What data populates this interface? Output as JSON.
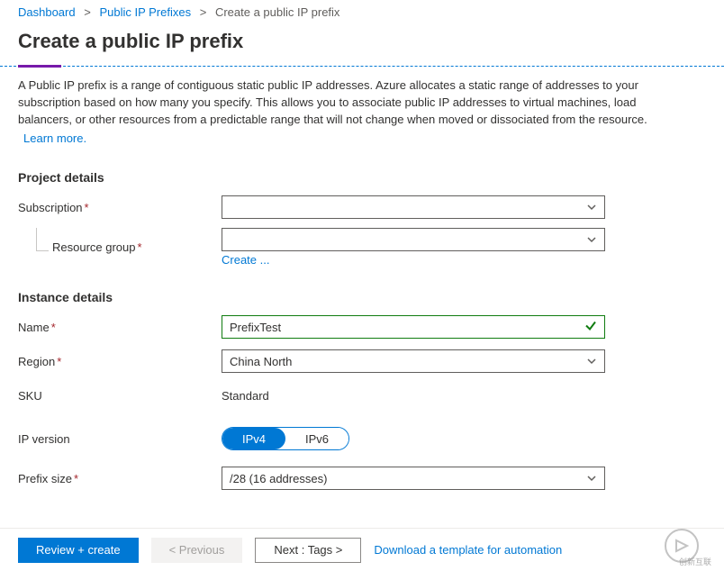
{
  "breadcrumb": {
    "dashboard": "Dashboard",
    "prefixes": "Public IP Prefixes",
    "current": "Create a public IP prefix"
  },
  "page": {
    "title": "Create a public IP prefix",
    "description": "A Public IP prefix is a range of contiguous static public IP addresses. Azure allocates a static range of addresses to your subscription based on how many you specify. This allows you to associate public IP addresses to virtual machines, load balancers, or other resources from a predictable range that will not change when moved or dissociated from the resource.",
    "learn_more": "Learn more."
  },
  "sections": {
    "project_details": "Project details",
    "instance_details": "Instance details"
  },
  "labels": {
    "subscription": "Subscription",
    "resource_group": "Resource group",
    "name": "Name",
    "region": "Region",
    "sku": "SKU",
    "ip_version": "IP version",
    "prefix_size": "Prefix size",
    "required_marker": "*"
  },
  "values": {
    "subscription": "",
    "resource_group": "",
    "create_new": "Create ...",
    "name": "PrefixTest",
    "region": "China North",
    "sku": "Standard",
    "ip_v4": "IPv4",
    "ip_v6": "IPv6",
    "prefix_size": "/28 (16 addresses)"
  },
  "footer": {
    "review_create": "Review + create",
    "previous": "< Previous",
    "next": "Next : Tags >",
    "download": "Download a template for automation"
  },
  "watermark": "创新互联"
}
